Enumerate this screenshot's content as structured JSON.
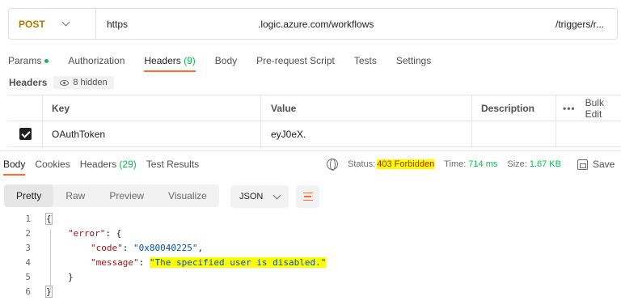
{
  "request": {
    "method": "POST",
    "url_parts": [
      "https",
      ".logic.azure.com/workflows",
      "/triggers/r..."
    ]
  },
  "request_tabs": {
    "params": "Params",
    "authorization": "Authorization",
    "headers_label": "Headers",
    "headers_count": "(9)",
    "body": "Body",
    "prerequest": "Pre-request Script",
    "tests": "Tests",
    "settings": "Settings"
  },
  "headers_section": {
    "label": "Headers",
    "hidden": "8 hidden"
  },
  "table": {
    "columns": [
      "Key",
      "Value",
      "Description"
    ],
    "more": "•••",
    "bulk_edit": "Bulk Edit",
    "rows": [
      {
        "key": "OAuthToken",
        "value": "eyJ0eX.",
        "description": ""
      }
    ]
  },
  "response": {
    "tabs": {
      "body": "Body",
      "cookies": "Cookies",
      "headers_label": "Headers",
      "headers_count": "(29)",
      "test_results": "Test Results"
    },
    "status_label": "Status:",
    "status_value": "403 Forbidden",
    "time_label": "Time:",
    "time_value": "714 ms",
    "size_label": "Size:",
    "size_value": "1.67 KB",
    "save": "Save",
    "views": [
      "Pretty",
      "Raw",
      "Preview",
      "Visualize"
    ],
    "format": "JSON",
    "code": {
      "line_numbers": [
        "1",
        "2",
        "3",
        "4",
        "5",
        "6"
      ],
      "open_brace": "{",
      "error_key": "\"error\"",
      "code_key": "\"code\"",
      "code_value": "\"0x80040225\"",
      "message_key": "\"message\"",
      "message_value": "\"The specified user is disabled.\"",
      "close_inner": "}",
      "close_outer": "}"
    }
  }
}
